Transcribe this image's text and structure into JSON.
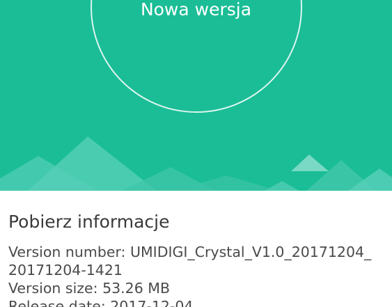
{
  "hero": {
    "title": "Nowa wersja",
    "background_color": "#1abd96"
  },
  "info": {
    "heading": "Pobierz informacje",
    "version_number_line1": "Version number: UMIDIGI_Crystal_V1.0_20171204_",
    "version_number_line2": "20171204-1421",
    "version_size": "Version size: 53.26 MB",
    "release_date_partial": "Release date: 2017-12-04"
  }
}
